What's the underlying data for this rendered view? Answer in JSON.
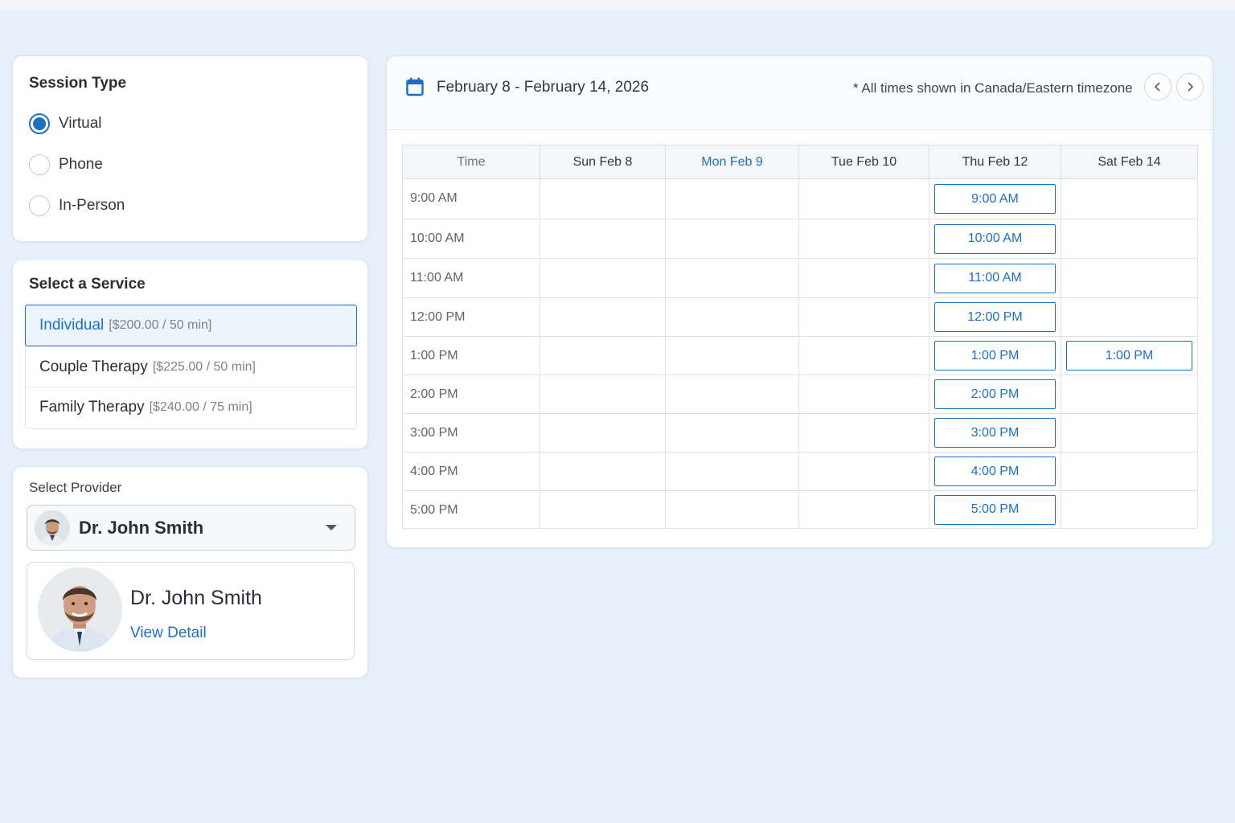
{
  "session_type": {
    "title": "Session Type",
    "options": [
      {
        "label": "Virtual",
        "checked": true
      },
      {
        "label": "Phone",
        "checked": false
      },
      {
        "label": "In-Person",
        "checked": false
      }
    ]
  },
  "services": {
    "title": "Select a Service",
    "items": [
      {
        "name": "Individual",
        "meta": "[$200.00 /   50 min]",
        "selected": true
      },
      {
        "name": "Couple Therapy",
        "meta": "[$225.00 / 50 min]",
        "selected": false
      },
      {
        "name": "Family Therapy",
        "meta": "[$240.00 / 75 min]",
        "selected": false
      }
    ]
  },
  "provider": {
    "label": "Select Provider",
    "selected_name": "Dr. John Smith",
    "detail_name": "Dr. John Smith",
    "view_detail": "View Detail"
  },
  "calendar": {
    "date_range": "February 8 - February 14, 2026",
    "timezone_note": "* All times shown in Canada/Eastern timezone",
    "headers": [
      "Time",
      "Sun Feb 8",
      "Mon Feb 9",
      "Tue Feb 10",
      "Thu Feb 12",
      "Sat Feb 14"
    ],
    "today_header": "Mon Feb 9",
    "rows": [
      {
        "time": "9:00 AM",
        "thu": "9:00 AM",
        "sat": ""
      },
      {
        "time": "10:00 AM",
        "thu": "10:00 AM",
        "sat": ""
      },
      {
        "time": "11:00 AM",
        "thu": "11:00 AM",
        "sat": ""
      },
      {
        "time": "12:00 PM",
        "thu": "12:00 PM",
        "sat": ""
      },
      {
        "time": "1:00 PM",
        "thu": "1:00 PM",
        "sat": "1:00 PM"
      },
      {
        "time": "2:00 PM",
        "thu": "2:00 PM",
        "sat": ""
      },
      {
        "time": "3:00 PM",
        "thu": "3:00 PM",
        "sat": ""
      },
      {
        "time": "4:00 PM",
        "thu": "4:00 PM",
        "sat": ""
      },
      {
        "time": "5:00 PM",
        "thu": "5:00 PM",
        "sat": ""
      }
    ]
  },
  "icons": {
    "calendar": "calendar-icon",
    "prev": "chevron-left-icon",
    "next": "chevron-right-icon",
    "dropdown": "caret-down-icon"
  },
  "colors": {
    "accent": "#1c6fc6",
    "page_bg": "#e6f0fb",
    "selected_bg": "#ecf4fe"
  }
}
